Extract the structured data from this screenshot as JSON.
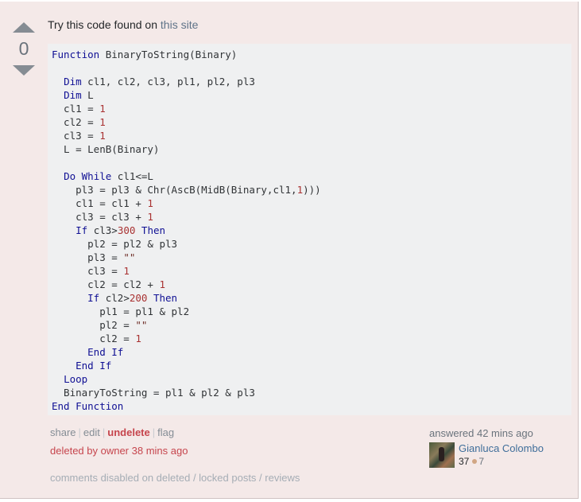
{
  "vote": {
    "count": "0"
  },
  "intro": {
    "text": "Try this code found on ",
    "link": "this site"
  },
  "menu": {
    "share": "share",
    "edit": "edit",
    "undelete": "undelete",
    "flag": "flag",
    "sep": "|"
  },
  "deleted_note": "deleted by owner 38 mins ago",
  "signature": {
    "answered": "answered 42 mins ago",
    "user_name": "Gianluca Colombo",
    "reputation": "37",
    "bronze_badges": "7"
  },
  "comments_note": "comments disabled on deleted / locked posts / reviews",
  "code": [
    [
      [
        "k",
        "Function"
      ],
      [
        "t",
        " BinaryToString(Binary)"
      ]
    ],
    [],
    [
      [
        "t",
        "  "
      ],
      [
        "k",
        "Dim"
      ],
      [
        "t",
        " cl1, cl2, cl3, pl1, pl2, pl3"
      ]
    ],
    [
      [
        "t",
        "  "
      ],
      [
        "k",
        "Dim"
      ],
      [
        "t",
        " L"
      ]
    ],
    [
      [
        "t",
        "  cl1 = "
      ],
      [
        "n",
        "1"
      ]
    ],
    [
      [
        "t",
        "  cl2 = "
      ],
      [
        "n",
        "1"
      ]
    ],
    [
      [
        "t",
        "  cl3 = "
      ],
      [
        "n",
        "1"
      ]
    ],
    [
      [
        "t",
        "  L = LenB(Binary)"
      ]
    ],
    [],
    [
      [
        "t",
        "  "
      ],
      [
        "k",
        "Do While"
      ],
      [
        "t",
        " cl1<=L"
      ]
    ],
    [
      [
        "t",
        "    pl3 = pl3 & Chr(AscB(MidB(Binary,cl1,"
      ],
      [
        "n",
        "1"
      ],
      [
        "t",
        ")))"
      ]
    ],
    [
      [
        "t",
        "    cl1 = cl1 + "
      ],
      [
        "n",
        "1"
      ]
    ],
    [
      [
        "t",
        "    cl3 = cl3 + "
      ],
      [
        "n",
        "1"
      ]
    ],
    [
      [
        "t",
        "    "
      ],
      [
        "k",
        "If"
      ],
      [
        "t",
        " cl3>"
      ],
      [
        "n",
        "300"
      ],
      [
        "t",
        " "
      ],
      [
        "k",
        "Then"
      ]
    ],
    [
      [
        "t",
        "      pl2 = pl2 & pl3"
      ]
    ],
    [
      [
        "t",
        "      pl3 = "
      ],
      [
        "s",
        "\"\""
      ]
    ],
    [
      [
        "t",
        "      cl3 = "
      ],
      [
        "n",
        "1"
      ]
    ],
    [
      [
        "t",
        "      cl2 = cl2 + "
      ],
      [
        "n",
        "1"
      ]
    ],
    [
      [
        "t",
        "      "
      ],
      [
        "k",
        "If"
      ],
      [
        "t",
        " cl2>"
      ],
      [
        "n",
        "200"
      ],
      [
        "t",
        " "
      ],
      [
        "k",
        "Then"
      ]
    ],
    [
      [
        "t",
        "        pl1 = pl1 & pl2"
      ]
    ],
    [
      [
        "t",
        "        pl2 = "
      ],
      [
        "s",
        "\"\""
      ]
    ],
    [
      [
        "t",
        "        cl2 = "
      ],
      [
        "n",
        "1"
      ]
    ],
    [
      [
        "t",
        "      "
      ],
      [
        "k",
        "End If"
      ]
    ],
    [
      [
        "t",
        "    "
      ],
      [
        "k",
        "End If"
      ]
    ],
    [
      [
        "t",
        "  "
      ],
      [
        "k",
        "Loop"
      ]
    ],
    [
      [
        "t",
        "  BinaryToString = pl1 & pl2 & pl3"
      ]
    ],
    [
      [
        "k",
        "End Function"
      ]
    ]
  ]
}
